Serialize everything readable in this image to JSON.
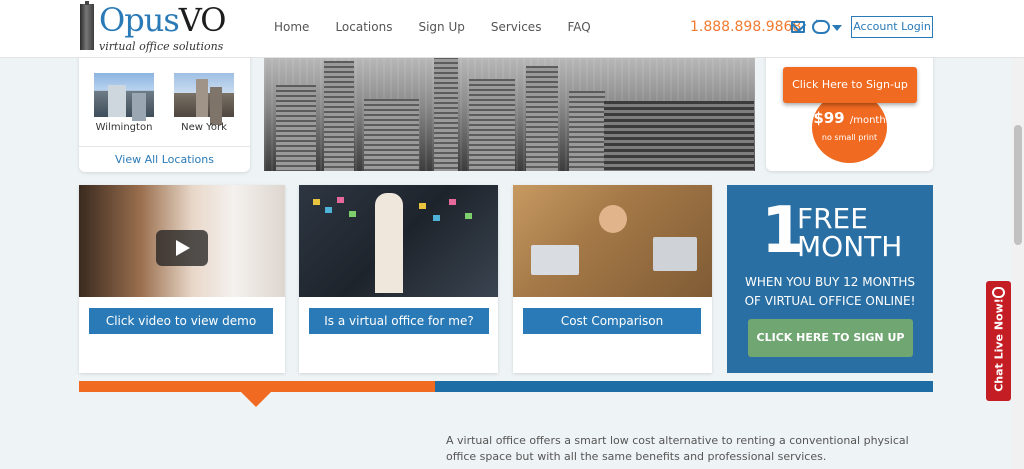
{
  "brand": {
    "name_part1": "Opus",
    "name_part2": "VO",
    "tagline": "virtual office solutions"
  },
  "nav": {
    "items": [
      "Home",
      "Locations",
      "Sign Up",
      "Services",
      "FAQ"
    ]
  },
  "header": {
    "phone": "1.888.898.9868",
    "login_label": "Account Login"
  },
  "locations": {
    "items": [
      "Wilmington",
      "New York"
    ],
    "view_all": "View All Locations"
  },
  "signup": {
    "button_label": "Click Here to Sign-up",
    "price": "$99",
    "price_unit": "/month",
    "price_note": "no small print"
  },
  "features": [
    {
      "cta": "Click video to view demo"
    },
    {
      "cta": "Is a virtual office for me?"
    },
    {
      "cta": "Cost Comparison"
    }
  ],
  "promo": {
    "number": "1",
    "line1": "FREE",
    "line2": "MONTH",
    "sub_line1": "WHEN YOU BUY 12 MONTHS",
    "sub_line2": "OF VIRTUAL OFFICE ONLINE!",
    "button_label": "CLICK HERE TO SIGN UP"
  },
  "intro_text": "A virtual office offers a smart low cost alternative to renting a conventional physical office space but with all the same benefits and professional services.",
  "chat_tab": "Chat Live Now!",
  "colors": {
    "brand_blue": "#2a7ab7",
    "accent_orange": "#f06a22",
    "promo_blue": "#2a6fa3",
    "promo_green": "#6fa671",
    "chat_red": "#c41e24"
  }
}
